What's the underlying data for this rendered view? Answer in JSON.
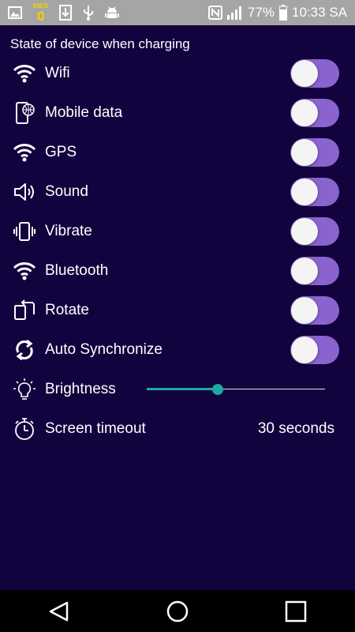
{
  "status_bar": {
    "kbs_unit": "KB/S",
    "kbs_value": "0",
    "battery_percent": "77%",
    "time": "10:33 SA",
    "icons": [
      "image-icon",
      "download-icon",
      "usb-icon",
      "android-debug-icon",
      "nfc-icon",
      "signal-icon",
      "battery-icon"
    ]
  },
  "section_title": "State of device when charging",
  "settings": {
    "wifi": {
      "label": "Wifi",
      "icon": "wifi-icon",
      "on": true
    },
    "mobile_data": {
      "label": "Mobile data",
      "icon": "mobile-data-icon",
      "on": true
    },
    "gps": {
      "label": "GPS",
      "icon": "gps-icon",
      "on": true
    },
    "sound": {
      "label": "Sound",
      "icon": "speaker-icon",
      "on": true
    },
    "vibrate": {
      "label": "Vibrate",
      "icon": "vibrate-icon",
      "on": true
    },
    "bluetooth": {
      "label": "Bluetooth",
      "icon": "bluetooth-icon",
      "on": true
    },
    "rotate": {
      "label": "Rotate",
      "icon": "rotate-icon",
      "on": true
    },
    "auto_sync": {
      "label": "Auto Synchronize",
      "icon": "sync-icon",
      "on": true
    },
    "brightness": {
      "label": "Brightness",
      "icon": "lightbulb-icon",
      "level": 0.4
    },
    "screen_timeout": {
      "label": "Screen timeout",
      "icon": "stopwatch-icon",
      "value": "30 seconds"
    }
  },
  "colors": {
    "background": "#12033f",
    "toggle_on": "#8a63cf",
    "slider_accent": "#1fa8a0",
    "status_bar": "#a5a5a5"
  },
  "nav": {
    "icons": [
      "back-icon",
      "home-icon",
      "recents-icon"
    ]
  }
}
